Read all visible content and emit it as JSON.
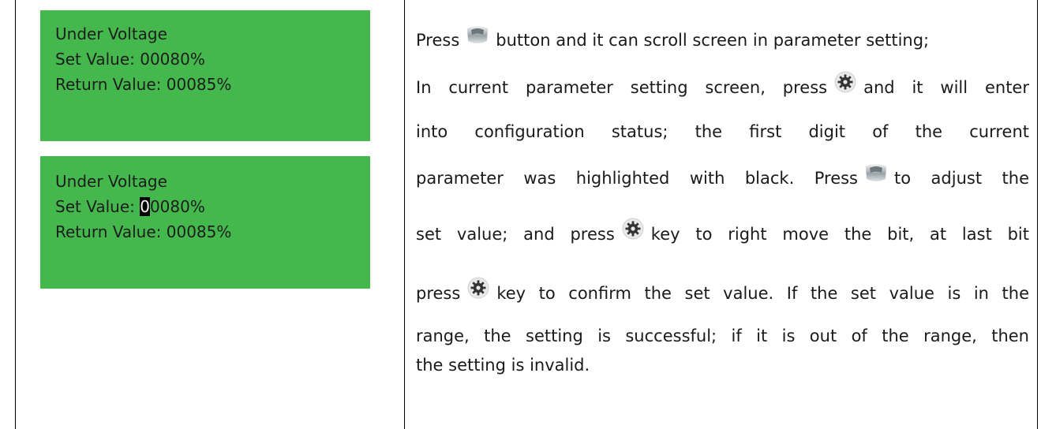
{
  "lcd_screen_1": {
    "title": "Under Voltage",
    "set_label": "Set Value: ",
    "set_value": "00080%",
    "return_label": "Return Value: ",
    "return_value": "00085%"
  },
  "lcd_screen_2": {
    "title": "Under Voltage",
    "set_label": "Set Value: ",
    "set_value_highlight": "0",
    "set_value_rest": "0080%",
    "return_label": "Return Value: ",
    "return_value": "00085%"
  },
  "instructions": {
    "l1_a": "Press",
    "l1_b": "button and it can scroll screen in parameter setting;",
    "l2_a": "In current parameter setting screen, press",
    "l2_b": "and it will enter",
    "l3": "into configuration status; the first digit of the current",
    "l4_a": "parameter was highlighted with black. Press",
    "l4_b": "to adjust the",
    "l5_a": "set value; and press",
    "l5_b": "key to right move the bit, at last bit",
    "l6_a": "press",
    "l6_b": "key to confirm the set value. If the set value is in the",
    "l7": "range, the setting is successful; if it is out of the range, then",
    "l8": "the setting is invalid."
  },
  "icons": {
    "scroll_button": "scroll-button-icon",
    "set_button": "gear-icon"
  },
  "colors": {
    "lcd_background": "#44b84c",
    "highlight": "#000000"
  }
}
